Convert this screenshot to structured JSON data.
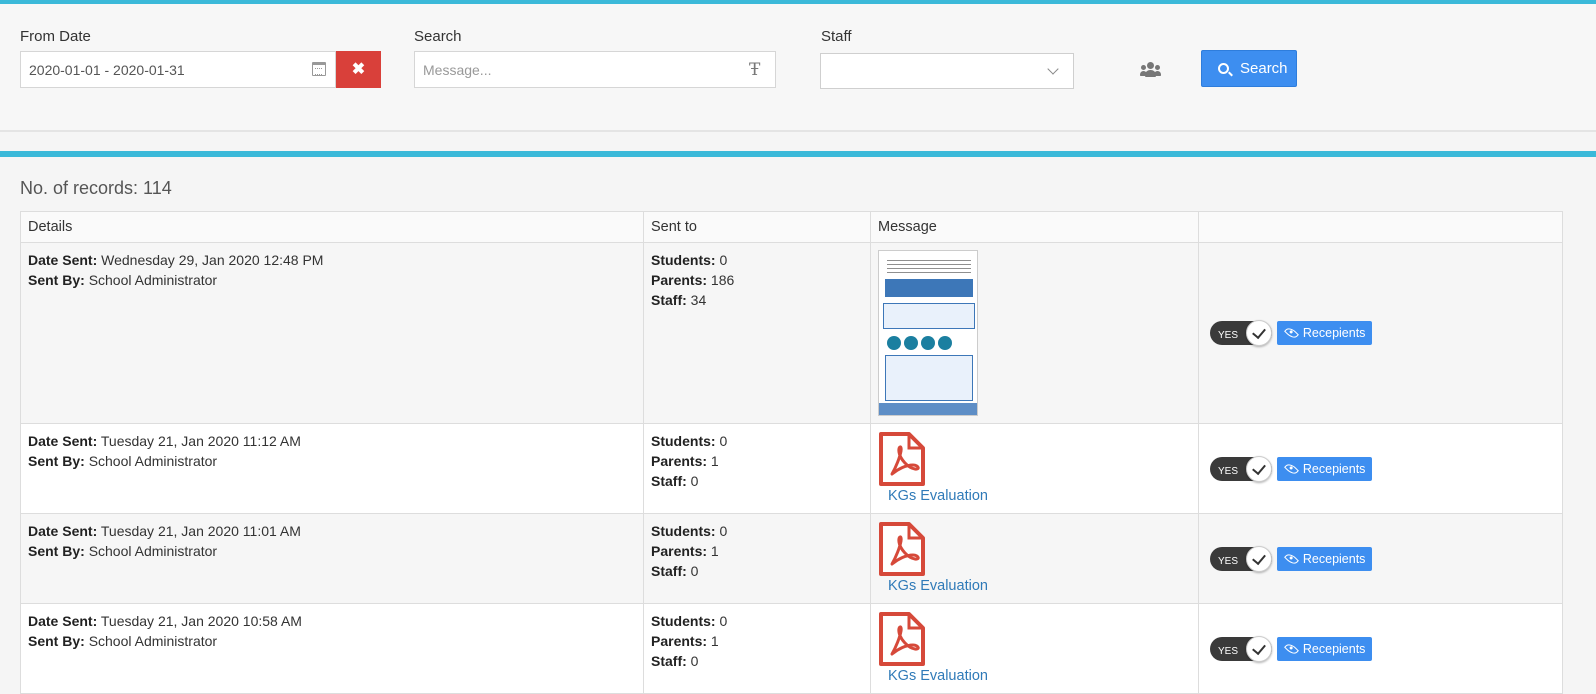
{
  "filters": {
    "from_date_label": "From Date",
    "date_range_value": "2020-01-01 - 2020-01-31",
    "search_label": "Search",
    "search_placeholder": "Message...",
    "staff_label": "Staff",
    "staff_selected": "",
    "search_button_label": "Search"
  },
  "records_text": "No. of records: 114",
  "table": {
    "headers": [
      "Details",
      "Sent to",
      "Message",
      ""
    ],
    "rows": [
      {
        "date_sent_label": "Date Sent:",
        "date_sent": "Wednesday 29, Jan 2020 12:48 PM",
        "sent_by_label": "Sent By:",
        "sent_by": "School Administrator",
        "students_label": "Students:",
        "students": "0",
        "parents_label": "Parents:",
        "parents": "186",
        "staff_label": "Staff:",
        "staff": "34",
        "message_type": "image",
        "toggle_label": "YES",
        "recipients_label": "Recepients"
      },
      {
        "date_sent_label": "Date Sent:",
        "date_sent": "Tuesday 21, Jan 2020 11:12 AM",
        "sent_by_label": "Sent By:",
        "sent_by": "School Administrator",
        "students_label": "Students:",
        "students": "0",
        "parents_label": "Parents:",
        "parents": "1",
        "staff_label": "Staff:",
        "staff": "0",
        "message_type": "pdf",
        "message_caption": "KGs Evaluation",
        "toggle_label": "YES",
        "recipients_label": "Recepients"
      },
      {
        "date_sent_label": "Date Sent:",
        "date_sent": "Tuesday 21, Jan 2020 11:01 AM",
        "sent_by_label": "Sent By:",
        "sent_by": "School Administrator",
        "students_label": "Students:",
        "students": "0",
        "parents_label": "Parents:",
        "parents": "1",
        "staff_label": "Staff:",
        "staff": "0",
        "message_type": "pdf",
        "message_caption": "KGs Evaluation",
        "toggle_label": "YES",
        "recipients_label": "Recepients"
      },
      {
        "date_sent_label": "Date Sent:",
        "date_sent": "Tuesday 21, Jan 2020 10:58 AM",
        "sent_by_label": "Sent By:",
        "sent_by": "School Administrator",
        "students_label": "Students:",
        "students": "0",
        "parents_label": "Parents:",
        "parents": "1",
        "staff_label": "Staff:",
        "staff": "0",
        "message_type": "pdf",
        "message_caption": "KGs Evaluation",
        "toggle_label": "YES",
        "recipients_label": "Recepients"
      }
    ]
  },
  "icons": {
    "calendar": "calendar-icon",
    "clear": "close-icon",
    "text_format": "text-format-icon",
    "dropdown": "chevron-down-icon",
    "users": "users-icon",
    "search": "search-icon",
    "pdf": "pdf-file-icon",
    "eye": "eye-icon",
    "check": "check-icon"
  },
  "colors": {
    "accent_line": "#3bb9d9",
    "primary_button": "#3d8ef0",
    "danger_button": "#d9403a",
    "pdf_red": "#d6493a",
    "link": "#2f7ab8"
  }
}
